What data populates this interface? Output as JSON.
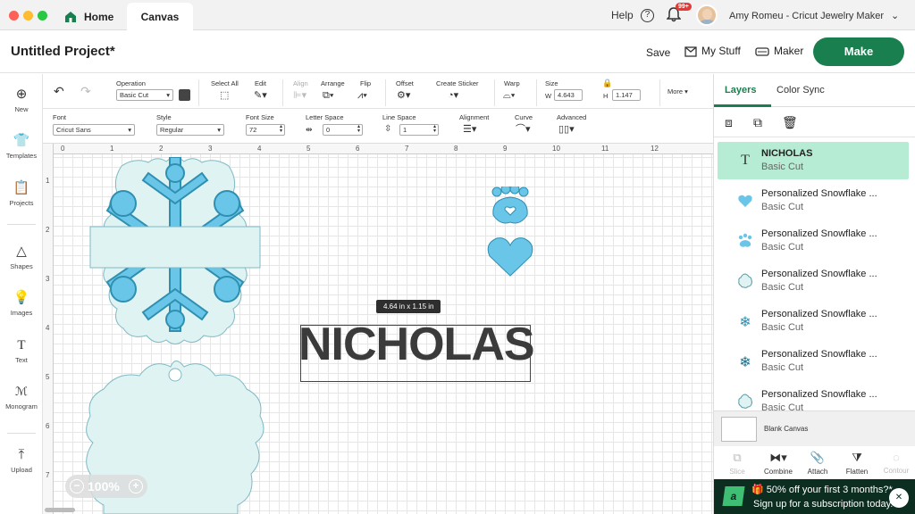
{
  "titlebar": {
    "home_tab": "Home",
    "canvas_tab": "Canvas",
    "help_label": "Help",
    "notifications_badge": "99+",
    "user_name": "Amy Romeu - Cricut Jewelry Maker"
  },
  "header": {
    "project_title": "Untitled Project*",
    "save_label": "Save",
    "my_stuff_label": "My Stuff",
    "machine_label": "Maker",
    "make_label": "Make"
  },
  "toolbar": {
    "operation_label": "Operation",
    "operation_value": "Basic Cut",
    "select_all_label": "Select All",
    "edit_label": "Edit",
    "align_label": "Align",
    "arrange_label": "Arrange",
    "flip_label": "Flip",
    "offset_label": "Offset",
    "create_sticker_label": "Create Sticker",
    "warp_label": "Warp",
    "size_label": "Size",
    "width_label": "W",
    "width_value": "4.643",
    "height_label": "H",
    "height_value": "1.147",
    "more_label": "More",
    "font_label": "Font",
    "font_value": "Cricut Sans",
    "style_label": "Style",
    "style_value": "Regular",
    "font_size_label": "Font Size",
    "font_size_value": "72",
    "letter_space_label": "Letter Space",
    "letter_space_value": "0",
    "line_space_label": "Line Space",
    "line_space_value": "1",
    "alignment_label": "Alignment",
    "curve_label": "Curve",
    "advanced_label": "Advanced"
  },
  "sidebar": {
    "items": [
      {
        "label": "New"
      },
      {
        "label": "Templates"
      },
      {
        "label": "Projects"
      },
      {
        "label": "Shapes"
      },
      {
        "label": "Images"
      },
      {
        "label": "Text"
      },
      {
        "label": "Monogram"
      },
      {
        "label": "Upload"
      }
    ]
  },
  "canvas": {
    "ruler_top": [
      "0",
      "1",
      "2",
      "3",
      "4",
      "5",
      "6",
      "7",
      "8",
      "9",
      "10",
      "11",
      "12"
    ],
    "ruler_left": [
      "1",
      "2",
      "3",
      "4",
      "5",
      "6",
      "7"
    ],
    "text_object": "NICHOLAS",
    "size_tooltip": "4.64  in x 1.15  in",
    "zoom_label": "100%"
  },
  "panel": {
    "tab_layers": "Layers",
    "tab_color_sync": "Color Sync",
    "layers": [
      {
        "name": "NICHOLAS",
        "type": "Basic Cut"
      },
      {
        "name": "Personalized Snowflake ...",
        "type": "Basic Cut"
      },
      {
        "name": "Personalized Snowflake ...",
        "type": "Basic Cut"
      },
      {
        "name": "Personalized Snowflake ...",
        "type": "Basic Cut"
      },
      {
        "name": "Personalized Snowflake ...",
        "type": "Basic Cut"
      },
      {
        "name": "Personalized Snowflake ...",
        "type": "Basic Cut"
      },
      {
        "name": "Personalized Snowflake ...",
        "type": "Basic Cut"
      }
    ],
    "blank_canvas_label": "Blank Canvas",
    "actions": [
      {
        "label": "Slice"
      },
      {
        "label": "Combine"
      },
      {
        "label": "Attach"
      },
      {
        "label": "Flatten"
      },
      {
        "label": "Contour"
      }
    ],
    "promo_line1": "50% off your first 3 months?*",
    "promo_line2": "Sign up for a subscription today."
  },
  "colors": {
    "accent_green": "#1a7f4e",
    "selected_layer": "#b6ecd3",
    "snowflake_light": "#dff3f3",
    "snowflake_mid": "#69c6e9",
    "snowflake_dark": "#2f8fb1",
    "promo_bg": "#0b2e21"
  }
}
